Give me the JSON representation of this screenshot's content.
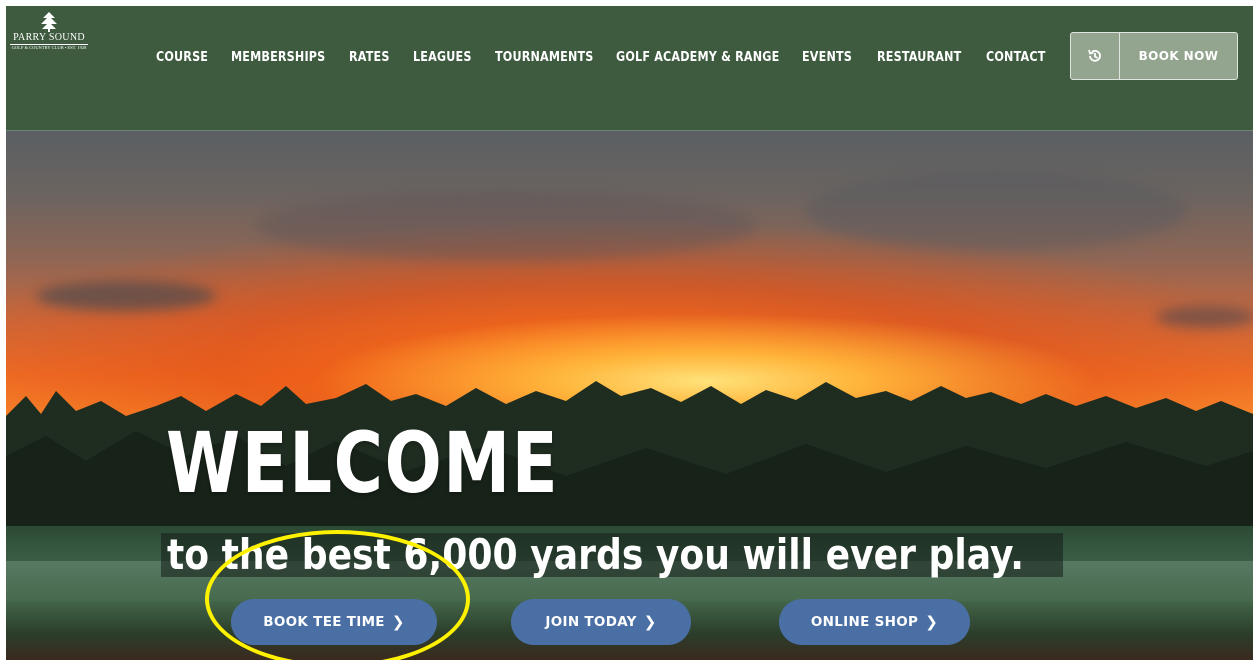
{
  "logo": {
    "name": "PARRY SOUND",
    "subtitle": "GOLF & COUNTRY CLUB • EST. 1928"
  },
  "nav": {
    "items": [
      {
        "label": "COURSE"
      },
      {
        "label": "MEMBERSHIPS"
      },
      {
        "label": "RATES"
      },
      {
        "label": "LEAGUES"
      },
      {
        "label": "TOURNAMENTS"
      },
      {
        "label": "GOLF ACADEMY & RANGE"
      },
      {
        "label": "EVENTS"
      },
      {
        "label": "RESTAURANT"
      },
      {
        "label": "CONTACT"
      }
    ],
    "book_now_label": "BOOK NOW",
    "history_icon": "history-icon"
  },
  "hero": {
    "headline": "WELCOME",
    "tagline": "to the best 6,000 yards you will ever play.",
    "buttons": [
      {
        "label": "BOOK TEE TIME"
      },
      {
        "label": "JOIN TODAY"
      },
      {
        "label": "ONLINE SHOP"
      }
    ],
    "chevron": "❯"
  },
  "colors": {
    "header_bg": "#3e5b40",
    "cta_bg": "#4a6fa5",
    "highlight": "#fff200",
    "book_box_bg": "#93a48f"
  }
}
